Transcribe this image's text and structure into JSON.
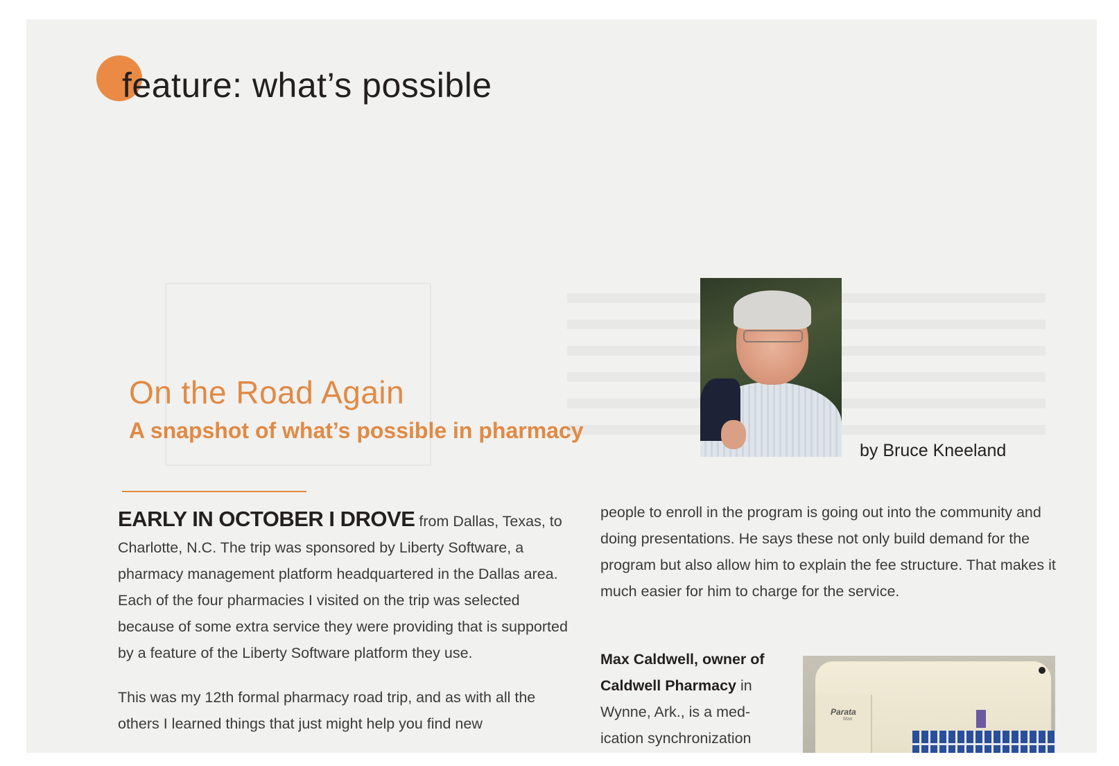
{
  "section": {
    "title": "feature: what’s possible",
    "accent_color": "#ea8a45"
  },
  "article": {
    "headline": "On the Road Again",
    "subheadline": "A snapshot of what’s possible in pharmacy",
    "byline": "by Bruce Kneeland",
    "accent_color": "#e08a45",
    "lead_in": "EARLY IN OCTOBER I DROVE",
    "left_column": {
      "paragraph_1": " from Dallas, Texas, to Charlotte, N.C. The trip was sponsored by Liberty Software, a pharmacy management platform headquartered in the Dallas area. Each of the four pharmacies I visited on the trip was selected because of some extra service they were pro­viding that is supported by a feature of the Liberty Software platform they use.",
      "paragraph_2": "This was my 12th formal pharmacy road trip, and as with all the others I learned things that just might help you find new"
    },
    "right_column": {
      "paragraph_1": "people to enroll in the program is going out into the com­munity and doing presentations. He says these not only build demand for the program but also allow him to explain the fee structure. That makes it much easier for him to charge for the service.",
      "bold_lead": "Max Caldwell, owner of Caldwell Pharmacy",
      "paragraph_2": " in Wynne, Ark., is a med­ication synchronization"
    }
  },
  "photos": {
    "author_photo": "author-portrait",
    "machine_photo": "parata-max-dispenser",
    "machine_label": "Parata",
    "machine_sublabel": "Max"
  }
}
